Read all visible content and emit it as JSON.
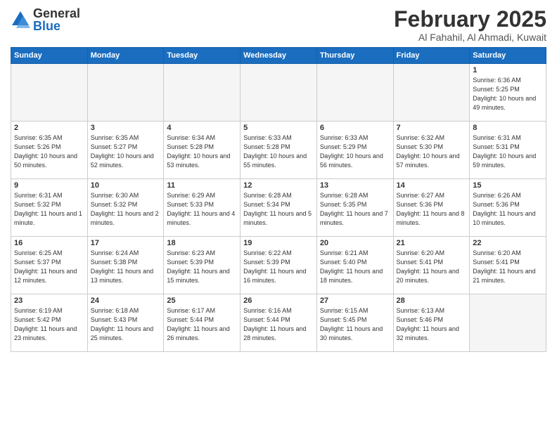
{
  "logo": {
    "general": "General",
    "blue": "Blue"
  },
  "header": {
    "month": "February 2025",
    "location": "Al Fahahil, Al Ahmadi, Kuwait"
  },
  "weekdays": [
    "Sunday",
    "Monday",
    "Tuesday",
    "Wednesday",
    "Thursday",
    "Friday",
    "Saturday"
  ],
  "weeks": [
    [
      {
        "day": "",
        "info": ""
      },
      {
        "day": "",
        "info": ""
      },
      {
        "day": "",
        "info": ""
      },
      {
        "day": "",
        "info": ""
      },
      {
        "day": "",
        "info": ""
      },
      {
        "day": "",
        "info": ""
      },
      {
        "day": "1",
        "info": "Sunrise: 6:36 AM\nSunset: 5:25 PM\nDaylight: 10 hours and 49 minutes."
      }
    ],
    [
      {
        "day": "2",
        "info": "Sunrise: 6:35 AM\nSunset: 5:26 PM\nDaylight: 10 hours and 50 minutes."
      },
      {
        "day": "3",
        "info": "Sunrise: 6:35 AM\nSunset: 5:27 PM\nDaylight: 10 hours and 52 minutes."
      },
      {
        "day": "4",
        "info": "Sunrise: 6:34 AM\nSunset: 5:28 PM\nDaylight: 10 hours and 53 minutes."
      },
      {
        "day": "5",
        "info": "Sunrise: 6:33 AM\nSunset: 5:28 PM\nDaylight: 10 hours and 55 minutes."
      },
      {
        "day": "6",
        "info": "Sunrise: 6:33 AM\nSunset: 5:29 PM\nDaylight: 10 hours and 56 minutes."
      },
      {
        "day": "7",
        "info": "Sunrise: 6:32 AM\nSunset: 5:30 PM\nDaylight: 10 hours and 57 minutes."
      },
      {
        "day": "8",
        "info": "Sunrise: 6:31 AM\nSunset: 5:31 PM\nDaylight: 10 hours and 59 minutes."
      }
    ],
    [
      {
        "day": "9",
        "info": "Sunrise: 6:31 AM\nSunset: 5:32 PM\nDaylight: 11 hours and 1 minute."
      },
      {
        "day": "10",
        "info": "Sunrise: 6:30 AM\nSunset: 5:32 PM\nDaylight: 11 hours and 2 minutes."
      },
      {
        "day": "11",
        "info": "Sunrise: 6:29 AM\nSunset: 5:33 PM\nDaylight: 11 hours and 4 minutes."
      },
      {
        "day": "12",
        "info": "Sunrise: 6:28 AM\nSunset: 5:34 PM\nDaylight: 11 hours and 5 minutes."
      },
      {
        "day": "13",
        "info": "Sunrise: 6:28 AM\nSunset: 5:35 PM\nDaylight: 11 hours and 7 minutes."
      },
      {
        "day": "14",
        "info": "Sunrise: 6:27 AM\nSunset: 5:36 PM\nDaylight: 11 hours and 8 minutes."
      },
      {
        "day": "15",
        "info": "Sunrise: 6:26 AM\nSunset: 5:36 PM\nDaylight: 11 hours and 10 minutes."
      }
    ],
    [
      {
        "day": "16",
        "info": "Sunrise: 6:25 AM\nSunset: 5:37 PM\nDaylight: 11 hours and 12 minutes."
      },
      {
        "day": "17",
        "info": "Sunrise: 6:24 AM\nSunset: 5:38 PM\nDaylight: 11 hours and 13 minutes."
      },
      {
        "day": "18",
        "info": "Sunrise: 6:23 AM\nSunset: 5:39 PM\nDaylight: 11 hours and 15 minutes."
      },
      {
        "day": "19",
        "info": "Sunrise: 6:22 AM\nSunset: 5:39 PM\nDaylight: 11 hours and 16 minutes."
      },
      {
        "day": "20",
        "info": "Sunrise: 6:21 AM\nSunset: 5:40 PM\nDaylight: 11 hours and 18 minutes."
      },
      {
        "day": "21",
        "info": "Sunrise: 6:20 AM\nSunset: 5:41 PM\nDaylight: 11 hours and 20 minutes."
      },
      {
        "day": "22",
        "info": "Sunrise: 6:20 AM\nSunset: 5:41 PM\nDaylight: 11 hours and 21 minutes."
      }
    ],
    [
      {
        "day": "23",
        "info": "Sunrise: 6:19 AM\nSunset: 5:42 PM\nDaylight: 11 hours and 23 minutes."
      },
      {
        "day": "24",
        "info": "Sunrise: 6:18 AM\nSunset: 5:43 PM\nDaylight: 11 hours and 25 minutes."
      },
      {
        "day": "25",
        "info": "Sunrise: 6:17 AM\nSunset: 5:44 PM\nDaylight: 11 hours and 26 minutes."
      },
      {
        "day": "26",
        "info": "Sunrise: 6:16 AM\nSunset: 5:44 PM\nDaylight: 11 hours and 28 minutes."
      },
      {
        "day": "27",
        "info": "Sunrise: 6:15 AM\nSunset: 5:45 PM\nDaylight: 11 hours and 30 minutes."
      },
      {
        "day": "28",
        "info": "Sunrise: 6:13 AM\nSunset: 5:46 PM\nDaylight: 11 hours and 32 minutes."
      },
      {
        "day": "",
        "info": ""
      }
    ]
  ]
}
